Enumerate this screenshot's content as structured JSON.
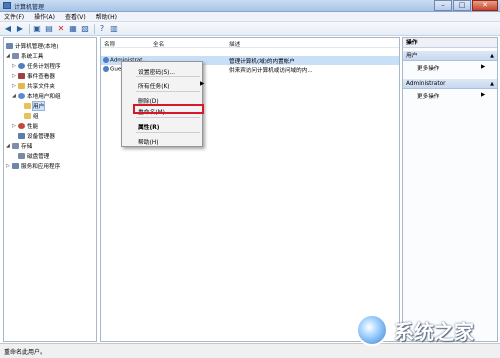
{
  "window": {
    "title": "计算机管理"
  },
  "window_buttons": {
    "minimize": "–",
    "maximize": "□",
    "close": "✕"
  },
  "menu": [
    "文件(F)",
    "操作(A)",
    "查看(V)",
    "帮助(H)"
  ],
  "tree": [
    {
      "label": "计算机管理(本地)",
      "icon": "computer-icon",
      "color": "#6a87b0"
    },
    {
      "label": "系统工具",
      "icon": "tools-icon",
      "color": "#7d8fa8"
    },
    {
      "label": "任务计划程序",
      "icon": "clock-icon",
      "color": "#4f7fbf"
    },
    {
      "label": "事件查看器",
      "icon": "event-viewer-icon",
      "color": "#a04040"
    },
    {
      "label": "共享文件夹",
      "icon": "shared-folder-icon",
      "color": "#e4b84c"
    },
    {
      "label": "本地用户和组",
      "icon": "users-icon",
      "color": "#5a8ad0"
    },
    {
      "label": "用户",
      "icon": "folder-icon",
      "color": "#e8c15a"
    },
    {
      "label": "组",
      "icon": "folder-icon",
      "color": "#e8c15a"
    },
    {
      "label": "性能",
      "icon": "performance-icon",
      "color": "#c04a3a"
    },
    {
      "label": "设备管理器",
      "icon": "device-manager-icon",
      "color": "#5c7ea8"
    },
    {
      "label": "存储",
      "icon": "storage-icon",
      "color": "#7d8fa8"
    },
    {
      "label": "磁盘管理",
      "icon": "disk-icon",
      "color": "#7a8aa0"
    },
    {
      "label": "服务和应用程序",
      "icon": "services-icon",
      "color": "#6a87b0"
    }
  ],
  "columns": {
    "name": "名称",
    "fullname": "全名",
    "description": "描述"
  },
  "rows": [
    {
      "name": "Administrat...",
      "fullname": "",
      "description": "管理计算机(域)的内置帐户"
    },
    {
      "name": "Gue",
      "fullname": "",
      "description": "供来宾访问计算机或访问域的内..."
    }
  ],
  "context_menu": {
    "set_password": "设置密码(S)...",
    "all_tasks": "所有任务(K)",
    "all_tasks_arrow": "▶",
    "delete": "删除(D)",
    "rename": "重命名(M)",
    "properties": "属性(R)",
    "help": "帮助(H)"
  },
  "actions": {
    "header": "操作",
    "section1": "用户",
    "section1_more": "更多操作",
    "section2": "Administrator",
    "section2_more": "更多操作",
    "arrow": "▶",
    "collapse": "▲"
  },
  "status": {
    "text": "重命名此用户。"
  },
  "watermark": {
    "text": "系统之家"
  },
  "colors": {
    "highlight": "#d6182a",
    "selection": "#c9dff8",
    "titlebar": "#a9c4e6"
  }
}
